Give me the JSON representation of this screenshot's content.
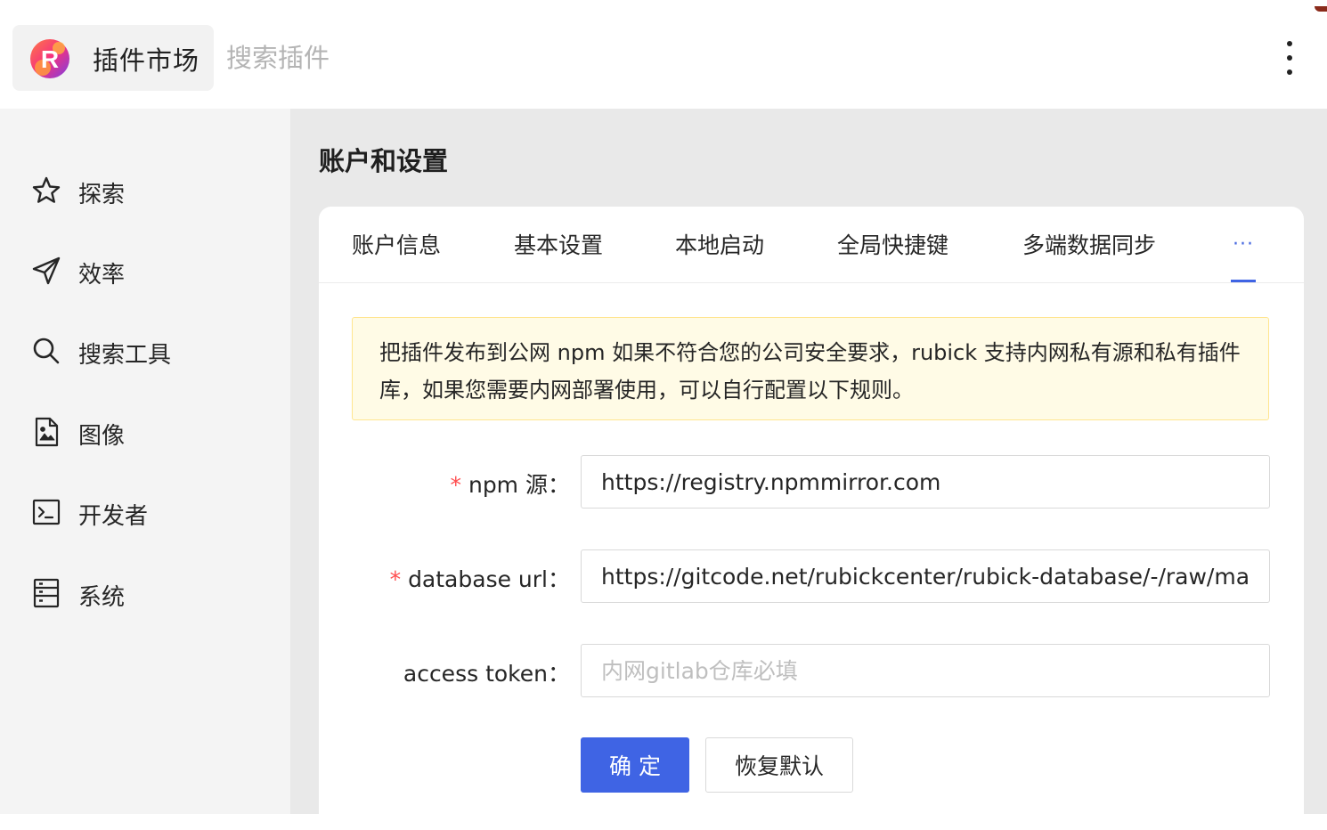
{
  "header": {
    "app_title": "插件市场",
    "search_placeholder": "搜索插件",
    "logo_letter": "R"
  },
  "sidebar": {
    "items": [
      {
        "label": "探索",
        "icon": "star-icon"
      },
      {
        "label": "效率",
        "icon": "send-icon"
      },
      {
        "label": "搜索工具",
        "icon": "search-icon"
      },
      {
        "label": "图像",
        "icon": "image-file-icon"
      },
      {
        "label": "开发者",
        "icon": "terminal-icon"
      },
      {
        "label": "系统",
        "icon": "system-list-icon"
      }
    ]
  },
  "main": {
    "page_title": "账户和设置",
    "tabs": [
      {
        "label": "账户信息"
      },
      {
        "label": "基本设置"
      },
      {
        "label": "本地启动"
      },
      {
        "label": "全局快捷键"
      },
      {
        "label": "多端数据同步"
      }
    ],
    "tab_more": "···",
    "alert": "把插件发布到公网 npm 如果不符合您的公司安全要求，rubick 支持内网私有源和私有插件库，如果您需要内网部署使用，可以自行配置以下规则。",
    "form": {
      "npm_label": "npm 源",
      "npm_value": "https://registry.npmmirror.com",
      "db_label": "database url",
      "db_value": "https://gitcode.net/rubickcenter/rubick-database/-/raw/master",
      "token_label": "access token",
      "token_placeholder": "内网gitlab仓库必填",
      "required_mark": "*",
      "colon": "："
    },
    "buttons": {
      "confirm": "确定",
      "reset": "恢复默认"
    }
  },
  "colors": {
    "primary": "#3f64e4",
    "required": "#ff4d4f",
    "alert_bg": "#fffbe6",
    "alert_border": "#ffe58f",
    "sidebar_bg": "#f4f4f4",
    "main_bg": "#e9e9e9"
  }
}
